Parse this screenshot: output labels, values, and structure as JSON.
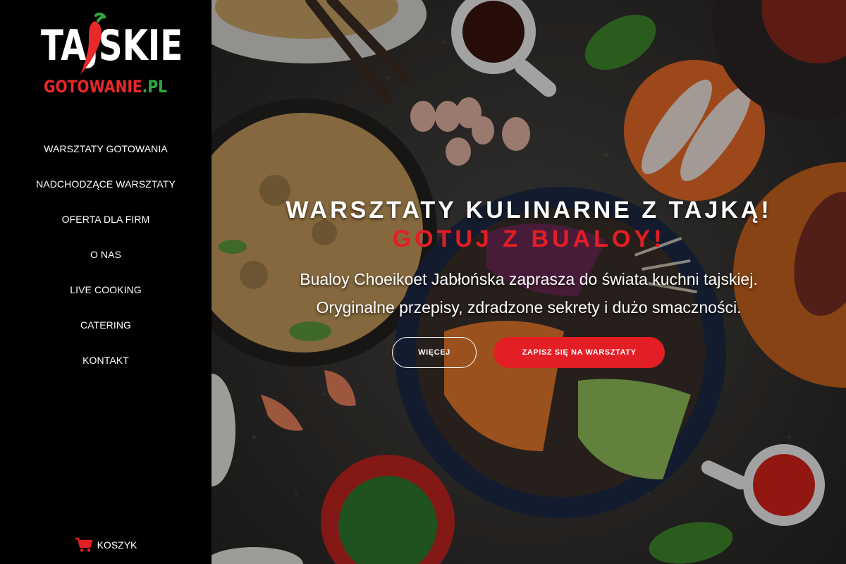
{
  "brand": {
    "logo_top": "TAJSKIE",
    "logo_bottom_red": "GOTOWANIE",
    "logo_bottom_green": ".PL",
    "logo_colors": {
      "white": "#ffffff",
      "red": "#e8282b",
      "green": "#2faa3f"
    }
  },
  "nav": {
    "items": [
      {
        "label": "WARSZTATY GOTOWANIA"
      },
      {
        "label": "NADCHODZĄCE WARSZTATY"
      },
      {
        "label": "OFERTA DLA FIRM"
      },
      {
        "label": "O NAS"
      },
      {
        "label": "LIVE COOKING"
      },
      {
        "label": "CATERING"
      },
      {
        "label": "KONTAKT"
      }
    ]
  },
  "cart": {
    "label": "KOSZYK",
    "icon": "shopping-cart-icon",
    "icon_color": "#e31e24"
  },
  "hero": {
    "headline": "WARSZTATY KULINARNE Z TAJKĄ!",
    "subheadline": "GOTUJ Z BUALOY!",
    "description_line1": "Bualoy Choeikoet Jabłońska zaprasza do świata kuchni tajskiej.",
    "description_line2": "Oryginalne przepisy, zdradzone sekrety i dużo smaczności.",
    "more_button": "WIĘCEJ",
    "signup_button": "ZAPISZ SIĘ NA WARSZTATY",
    "accent_color": "#e31e24"
  }
}
